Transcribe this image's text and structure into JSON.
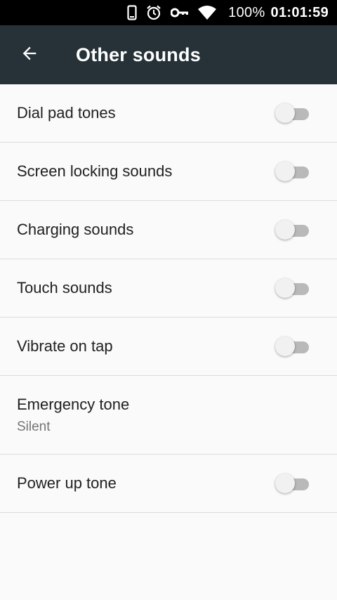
{
  "status_bar": {
    "battery": "100%",
    "time": "01:01:59",
    "icons": [
      "phone-icon",
      "alarm-icon",
      "vpn-key-icon",
      "wifi-icon"
    ]
  },
  "app_bar": {
    "title": "Other sounds",
    "back_icon": "arrow-back-icon",
    "background": "#263238"
  },
  "settings": [
    {
      "title": "Dial pad tones",
      "switch_on": false
    },
    {
      "title": "Screen locking sounds",
      "switch_on": false
    },
    {
      "title": "Charging sounds",
      "switch_on": false
    },
    {
      "title": "Touch sounds",
      "switch_on": false
    },
    {
      "title": "Vibrate on tap",
      "switch_on": false
    },
    {
      "title": "Emergency tone",
      "summary": "Silent"
    },
    {
      "title": "Power up tone",
      "switch_on": false
    }
  ]
}
